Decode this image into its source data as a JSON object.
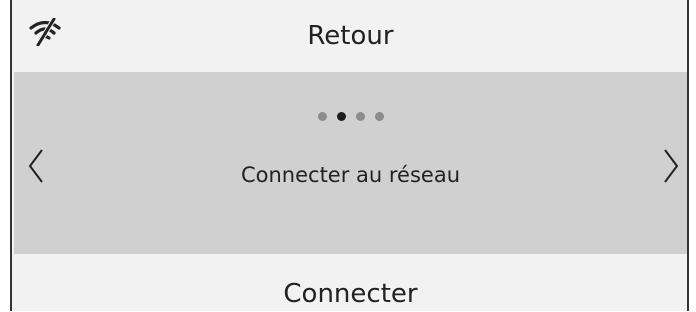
{
  "header": {
    "title": "Retour",
    "status_icon": "wifi-off-icon"
  },
  "carousel": {
    "pages_total": 4,
    "current_page": 2,
    "slide_title": "Connecter au réseau",
    "prev_icon": "chevron-left-icon",
    "next_icon": "chevron-right-icon"
  },
  "footer": {
    "action_label": "Connecter"
  },
  "colors": {
    "background_light": "#f2f2f2",
    "carousel_background": "#d0d0d0",
    "text": "#222222",
    "dot_inactive": "#8c8c8c",
    "dot_active": "#1e1e1e"
  }
}
